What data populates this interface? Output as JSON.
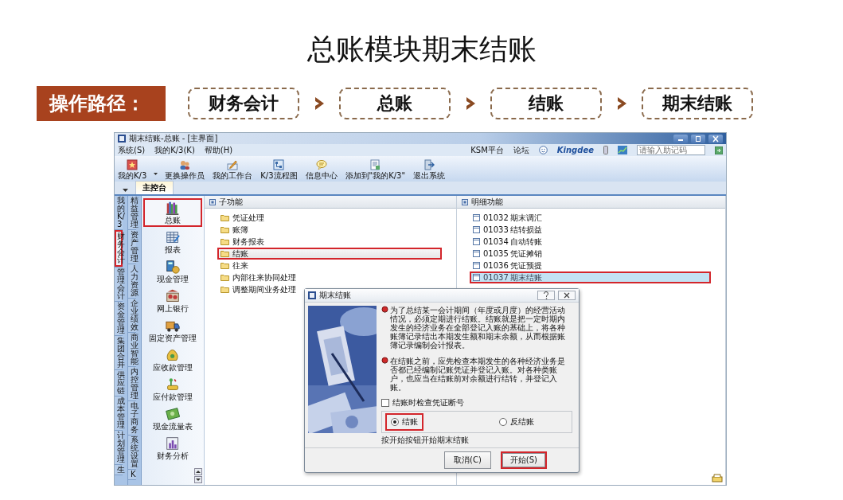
{
  "slide": {
    "title": "总账模块期末结账",
    "path_label": "操作路径：",
    "path_steps": [
      "财务会计",
      "总账",
      "结账",
      "期末结账"
    ]
  },
  "window": {
    "title": "期末结账-总账 - [主界面]"
  },
  "menu": [
    "系统(S)",
    "我的K/3(K)",
    "帮助(H)"
  ],
  "top_links": [
    "KSM平台",
    "论坛"
  ],
  "brand": "Kingdee",
  "search": {
    "placeholder": "请输入助记码"
  },
  "toolbar": [
    {
      "label": "我的K/3",
      "caret": true
    },
    {
      "label": "更换操作员",
      "caret": false
    },
    {
      "label": "我的工作台",
      "caret": false
    },
    {
      "label": "K/3流程图",
      "caret": false
    },
    {
      "label": "信息中心",
      "caret": false
    },
    {
      "label": "添加到\"我的K/3\"",
      "caret": false
    },
    {
      "label": "退出系统",
      "caret": false
    }
  ],
  "tabs": [
    {
      "label": "主控台",
      "selected": true
    }
  ],
  "nav_tabs": {
    "column_1": [
      {
        "label": "我的K/3",
        "selected": false,
        "highlighted": false
      },
      {
        "label": "财务会计",
        "selected": true,
        "highlighted": true
      },
      {
        "label": "管理会计",
        "selected": false,
        "highlighted": false
      },
      {
        "label": "资金管理",
        "selected": false,
        "highlighted": false
      },
      {
        "label": "集团合并",
        "selected": false,
        "highlighted": false
      },
      {
        "label": "供应链",
        "selected": false,
        "highlighted": false
      },
      {
        "label": "成本管理",
        "selected": false,
        "highlighted": false
      },
      {
        "label": "计划管理",
        "selected": false,
        "highlighted": false
      },
      {
        "label": "生",
        "selected": false,
        "highlighted": false
      }
    ],
    "column_2": [
      {
        "label": "精益管理",
        "selected": false,
        "highlighted": false
      },
      {
        "label": "资产管理",
        "selected": false,
        "highlighted": false
      },
      {
        "label": "人力资源",
        "selected": false,
        "highlighted": false
      },
      {
        "label": "企业绩效",
        "selected": false,
        "highlighted": false
      },
      {
        "label": "商业智能",
        "selected": false,
        "highlighted": false
      },
      {
        "label": "内控管理",
        "selected": false,
        "highlighted": false
      },
      {
        "label": "电子商务",
        "selected": false,
        "highlighted": false
      },
      {
        "label": "系统设置",
        "selected": false,
        "highlighted": false
      },
      {
        "label": "K",
        "selected": false,
        "highlighted": false
      }
    ]
  },
  "modules": [
    {
      "label": "总账",
      "selected": true,
      "highlighted": true
    },
    {
      "label": "报表",
      "selected": false,
      "highlighted": false
    },
    {
      "label": "现金管理",
      "selected": false,
      "highlighted": false
    },
    {
      "label": "网上银行",
      "selected": false,
      "highlighted": false
    },
    {
      "label": "固定资产管理",
      "selected": false,
      "highlighted": false
    },
    {
      "label": "应收款管理",
      "selected": false,
      "highlighted": false
    },
    {
      "label": "应付款管理",
      "selected": false,
      "highlighted": false
    },
    {
      "label": "现金流量表",
      "selected": false,
      "highlighted": false
    },
    {
      "label": "财务分析",
      "selected": false,
      "highlighted": false
    }
  ],
  "sub_functions": {
    "title": "子功能",
    "items": [
      {
        "label": "凭证处理",
        "selected": false,
        "highlighted": false
      },
      {
        "label": "账簿",
        "selected": false,
        "highlighted": false
      },
      {
        "label": "财务报表",
        "selected": false,
        "highlighted": false
      },
      {
        "label": "结账",
        "selected": true,
        "highlighted": true
      },
      {
        "label": "往来",
        "selected": false,
        "highlighted": false
      },
      {
        "label": "内部往来协同处理",
        "selected": false,
        "highlighted": false
      },
      {
        "label": "调整期间业务处理",
        "selected": false,
        "highlighted": false
      }
    ]
  },
  "detail_functions": {
    "title": "明细功能",
    "items": [
      {
        "code": "01032",
        "label": "期末调汇",
        "selected": false,
        "highlighted": false
      },
      {
        "code": "01033",
        "label": "结转损益",
        "selected": false,
        "highlighted": false
      },
      {
        "code": "01034",
        "label": "自动转账",
        "selected": false,
        "highlighted": false
      },
      {
        "code": "01035",
        "label": "凭证摊销",
        "selected": false,
        "highlighted": false
      },
      {
        "code": "01036",
        "label": "凭证预提",
        "selected": false,
        "highlighted": false
      },
      {
        "code": "01037",
        "label": "期末结账",
        "selected": true,
        "highlighted": true
      }
    ]
  },
  "dialog": {
    "title": "期末结账",
    "paragraphs": [
      "为了总结某一会计期间（年度或月度）的经营活动情况，必须定期进行结账。结账就是把一定时期内发生的经济业务在全部登记入账的基础上，将各种账簿记录结出本期发生额和期末余额，从而根据账簿记录编制会计报表。",
      "在结账之前，应先检查本期发生的各种经济业务是否都已经编制记账凭证并登记入账。对各种类账户，也应当在结账前对余额进行结转，并登记入账。"
    ],
    "check_gap": {
      "label": "结账时检查凭证断号",
      "checked": false
    },
    "options": [
      {
        "label": "结账",
        "selected": true,
        "framed": true
      },
      {
        "label": "反结账",
        "selected": false,
        "framed": false
      }
    ],
    "hint": "按开始按钮开始期末结账",
    "buttons": [
      {
        "label": "取消(C)",
        "highlighted": false
      },
      {
        "label": "开始(S)",
        "highlighted": true
      }
    ]
  }
}
